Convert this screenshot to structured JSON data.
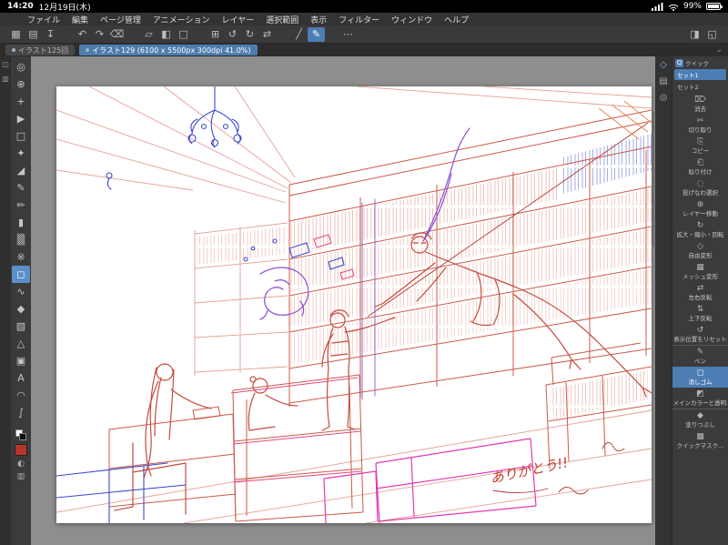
{
  "status_bar": {
    "time": "14:20",
    "date": "12月19日(木)",
    "battery": "99%"
  },
  "menu_bar": {
    "items": [
      "ファイル",
      "編集",
      "ページ管理",
      "アニメーション",
      "レイヤー",
      "選択範囲",
      "表示",
      "フィルター",
      "ウィンドウ",
      "ヘルプ"
    ]
  },
  "command_bar": {
    "icons": [
      {
        "name": "workspace-grid-icon",
        "glyph": "▦"
      },
      {
        "name": "page-manager-icon",
        "glyph": "▤"
      },
      {
        "name": "save-icon",
        "glyph": "↧"
      },
      {
        "name": "undo-icon",
        "glyph": "↶",
        "sep": true
      },
      {
        "name": "redo-icon",
        "glyph": "↷"
      },
      {
        "name": "delete-icon",
        "glyph": "⌫"
      },
      {
        "name": "deselect-icon",
        "glyph": "▱",
        "sep": true
      },
      {
        "name": "invert-selection-icon",
        "glyph": "◧"
      },
      {
        "name": "select-all-icon",
        "glyph": "□"
      },
      {
        "name": "fit-screen-icon",
        "glyph": "⊞",
        "sep": true
      },
      {
        "name": "rotate-ccw-icon",
        "glyph": "↺"
      },
      {
        "name": "rotate-cw-icon",
        "glyph": "↻"
      },
      {
        "name": "flip-horizontal-icon",
        "glyph": "⇄"
      },
      {
        "name": "straight-line-icon",
        "glyph": "╱",
        "sep": true
      },
      {
        "name": "pen-mode-icon",
        "glyph": "✎",
        "active": true
      },
      {
        "name": "more-icon",
        "glyph": "⋯",
        "sep": true
      }
    ],
    "right_icons": [
      {
        "name": "palette-toggle-icon",
        "glyph": "◨"
      },
      {
        "name": "fullscreen-icon",
        "glyph": "◱"
      }
    ]
  },
  "tab_bar": {
    "tabs": [
      {
        "label": "イラスト125回",
        "active": false
      },
      {
        "label": "イラスト129 (6100 x 5500px 300dpi 41.0%)",
        "active": true
      }
    ]
  },
  "edge_bar": {
    "icons": [
      {
        "name": "toolbar-collapse-icon",
        "glyph": "◫"
      },
      {
        "name": "subtool-panel-icon",
        "glyph": "▥"
      }
    ]
  },
  "tool_bar": {
    "main_color": "#b8352b",
    "tools": [
      {
        "name": "navigate-tool",
        "glyph": "◎"
      },
      {
        "name": "zoom-tool",
        "glyph": "⊕"
      },
      {
        "name": "move-tool",
        "glyph": "+"
      },
      {
        "name": "operation-tool",
        "glyph": "▶"
      },
      {
        "name": "selection-tool",
        "glyph": "□"
      },
      {
        "name": "auto-select-tool",
        "glyph": "✦"
      },
      {
        "name": "eyedropper-tool",
        "glyph": "◢"
      },
      {
        "name": "pen-tool",
        "glyph": "✎"
      },
      {
        "name": "pencil-tool",
        "glyph": "✏"
      },
      {
        "name": "brush-tool",
        "glyph": "▮"
      },
      {
        "name": "airbrush-tool",
        "glyph": "▒"
      },
      {
        "name": "decoration-tool",
        "glyph": "※"
      },
      {
        "name": "eraser-tool",
        "glyph": "◻",
        "selected": true
      },
      {
        "name": "blend-tool",
        "glyph": "∿"
      },
      {
        "name": "fill-tool",
        "glyph": "◆"
      },
      {
        "name": "gradient-tool",
        "glyph": "▧"
      },
      {
        "name": "figure-tool",
        "glyph": "△"
      },
      {
        "name": "frame-border-tool",
        "glyph": "▣"
      },
      {
        "name": "text-tool",
        "glyph": "A"
      },
      {
        "name": "balloon-tool",
        "glyph": "◠"
      },
      {
        "name": "line-correction-tool",
        "glyph": "∫"
      }
    ]
  },
  "dock": {
    "icons": [
      {
        "name": "quick-access-dock-icon",
        "glyph": "◇",
        "active": true
      },
      {
        "name": "material-dock-icon",
        "glyph": "▤"
      },
      {
        "name": "navigator-dock-icon",
        "glyph": "◎"
      }
    ]
  },
  "quick_access": {
    "badge": "Q",
    "title": "クイック",
    "sets": [
      {
        "label": "セット1",
        "active": true
      },
      {
        "label": "セット2",
        "active": false
      }
    ],
    "items": [
      {
        "name": "quick-item-clear",
        "glyph": "⌦",
        "label": "消去"
      },
      {
        "name": "quick-item-cut",
        "glyph": "✂",
        "label": "切り取り"
      },
      {
        "name": "quick-item-copy",
        "glyph": "⎘",
        "label": "コピー"
      },
      {
        "name": "quick-item-paste",
        "glyph": "⎗",
        "label": "貼り付け"
      },
      {
        "name": "quick-item-lasso-select",
        "glyph": "◌",
        "label": "投げなわ選択"
      },
      {
        "name": "quick-item-move-layer",
        "glyph": "⊕",
        "label": "レイヤー移動"
      },
      {
        "name": "quick-item-scale-rotate",
        "glyph": "↻",
        "label": "拡大・縮小・回転"
      },
      {
        "name": "quick-item-free-transform",
        "glyph": "◇",
        "label": "自由変形"
      },
      {
        "name": "quick-item-mesh-transform",
        "glyph": "▦",
        "label": "メッシュ変形"
      },
      {
        "name": "quick-item-flip-horizontal",
        "glyph": "⇄",
        "label": "左右反転"
      },
      {
        "name": "quick-item-flip-vertical",
        "glyph": "⇅",
        "label": "上下反転"
      },
      {
        "name": "quick-item-reset-display",
        "glyph": "↺",
        "label": "表示位置をリセット"
      },
      {
        "name": "quick-item-pen",
        "glyph": "✎",
        "label": "ペン",
        "sep": true
      },
      {
        "name": "quick-item-eraser",
        "glyph": "◻",
        "label": "消しゴム",
        "selected": true
      },
      {
        "name": "quick-item-main-color-transparent",
        "glyph": "◩",
        "label": "メインカラーと透明..."
      },
      {
        "name": "quick-item-fill",
        "glyph": "◆",
        "label": "塗りつぶし",
        "sep": true
      },
      {
        "name": "quick-item-quick-mask",
        "glyph": "▩",
        "label": "クイックマスク..."
      }
    ]
  },
  "artwork": {
    "note": "ありがとう!!"
  }
}
